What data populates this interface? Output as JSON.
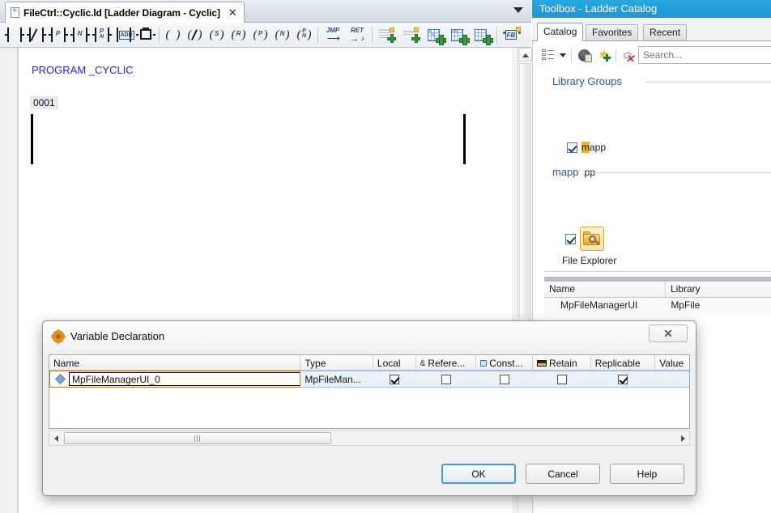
{
  "editor": {
    "tab": {
      "icon": "document-plus-icon",
      "title": "FileCtrl::Cyclic.ld [Ladder Diagram - Cyclic]",
      "close_label": "✕"
    },
    "overflow_icon": "chevron-down-icon",
    "toolbar": [
      {
        "name": "contact-no",
        "kind": "contact",
        "label": ""
      },
      {
        "name": "contact-nc",
        "kind": "contact-slash",
        "label": ""
      },
      {
        "name": "contact-positive",
        "kind": "contact",
        "label": "P"
      },
      {
        "name": "contact-negative",
        "kind": "contact",
        "label": "N"
      },
      {
        "name": "contact-pn",
        "kind": "contact2",
        "label": "P",
        "label2": "N"
      },
      {
        "name": "contact-address",
        "kind": "adr",
        "label": "ADR"
      },
      {
        "name": "contact-compare",
        "kind": "block",
        "label": ""
      },
      {
        "name": "coil",
        "kind": "coil",
        "label": ""
      },
      {
        "name": "coil-negated",
        "kind": "coil-slash",
        "label": ""
      },
      {
        "name": "coil-set",
        "kind": "coil",
        "label": "S"
      },
      {
        "name": "coil-reset",
        "kind": "coil",
        "label": "R"
      },
      {
        "name": "coil-positive",
        "kind": "coil",
        "label": "P"
      },
      {
        "name": "coil-negative",
        "kind": "coil",
        "label": "N"
      },
      {
        "name": "coil-pn",
        "kind": "coil2",
        "label": "P",
        "label2": "N"
      },
      {
        "name": "jump",
        "kind": "jmp",
        "label": "JMP"
      },
      {
        "name": "return",
        "kind": "ret",
        "label": "RET"
      },
      {
        "name": "insert-comment-row",
        "kind": "dash"
      },
      {
        "name": "insert-comment-line",
        "kind": "dash2"
      },
      {
        "name": "insert-network-above",
        "kind": "grid-a"
      },
      {
        "name": "insert-network-below",
        "kind": "grid-b"
      },
      {
        "name": "insert-network",
        "kind": "grid-c"
      },
      {
        "name": "insert-function-block",
        "kind": "fb",
        "label": "FB"
      }
    ],
    "program_label": "PROGRAM _CYCLIC",
    "rung_number": "0001"
  },
  "toolbox": {
    "title": "Toolbox - Ladder Catalog",
    "tabs": [
      {
        "label": "Catalog",
        "active": true
      },
      {
        "label": "Favorites",
        "active": false
      },
      {
        "label": "Recent",
        "active": false
      }
    ],
    "toolbar": {
      "view_icon": "list-view-icon",
      "dropdown_icon": "caret-down-icon",
      "globe_icon": "globe-library-icon",
      "favorite_icon": "add-favorite-star-icon",
      "clear_icon": "clear-filter-icon",
      "search_placeholder": "Search..."
    },
    "sections": [
      {
        "name": "library-groups",
        "title": "Library Groups"
      },
      {
        "name": "mapp",
        "title": "mapp"
      }
    ],
    "library_group": {
      "checked": true,
      "label_highlight": "m",
      "label_rest": "app",
      "sub_label": "mapp"
    },
    "catalog_item": {
      "checked": true,
      "icon": "folder-search-icon",
      "label": "File Explorer"
    },
    "grid": {
      "columns": [
        "Name",
        "Library"
      ],
      "rows": [
        [
          "MpFileManagerUI",
          "MpFile"
        ]
      ]
    }
  },
  "dialog": {
    "icon": "flower-icon",
    "title": "Variable Declaration",
    "close_label": "✕",
    "columns": [
      {
        "label": "Name",
        "icon": ""
      },
      {
        "label": "Type",
        "icon": ""
      },
      {
        "label": "Local",
        "icon": ""
      },
      {
        "label": "Refere...",
        "icon": "ampersand-icon"
      },
      {
        "label": "Const...",
        "icon": "lock-icon"
      },
      {
        "label": "Retain",
        "icon": "retain-icon"
      },
      {
        "label": "Replicable",
        "icon": ""
      },
      {
        "label": "Value",
        "icon": ""
      }
    ],
    "row": {
      "marker_icon": "diamond-variable-icon",
      "name_value": "MpFileManagerUI_0",
      "type_value": "MpFileMan...",
      "local": true,
      "reference": false,
      "constant": false,
      "retain": false,
      "replicable": true,
      "value": ""
    },
    "scrollbar": {
      "left_icon": "arrow-left-icon",
      "right_icon": "arrow-right-icon",
      "thumb_icon": "grip-icon"
    },
    "buttons": [
      {
        "label": "OK",
        "default": true
      },
      {
        "label": "Cancel",
        "default": false
      },
      {
        "label": "Help",
        "default": false
      }
    ]
  },
  "colors": {
    "toolbox_title_bg": "#1d95d4",
    "program_text": "#2424cc",
    "section_heading": "#2b5797",
    "highlight": "#f0b429",
    "focus_border": "#3f9fd4",
    "edit_border": "#c47b2e"
  }
}
